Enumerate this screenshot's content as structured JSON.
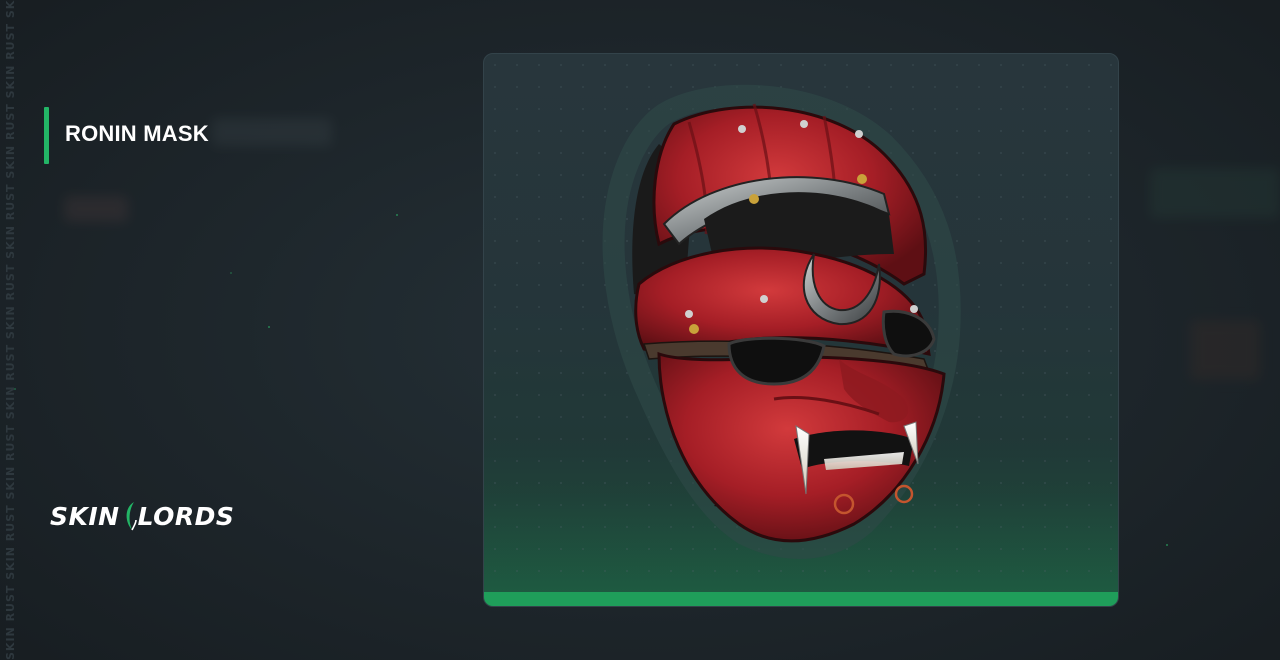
{
  "item": {
    "title": "RONIN MASK",
    "image_icon": "ronin-mask-image"
  },
  "brand": {
    "logo_left": "SKIN",
    "logo_right": "LORDS"
  },
  "watermark": {
    "text": "SKIN RUST SKIN RUST SKIN RUST SKIN RUST SKIN RUST SKIN RUST SKIN RUST SKIN RUST SKIN RUST"
  },
  "colors": {
    "accent": "#23b566",
    "bar": "#1f9e5a",
    "mask_red": "#b3222a"
  }
}
